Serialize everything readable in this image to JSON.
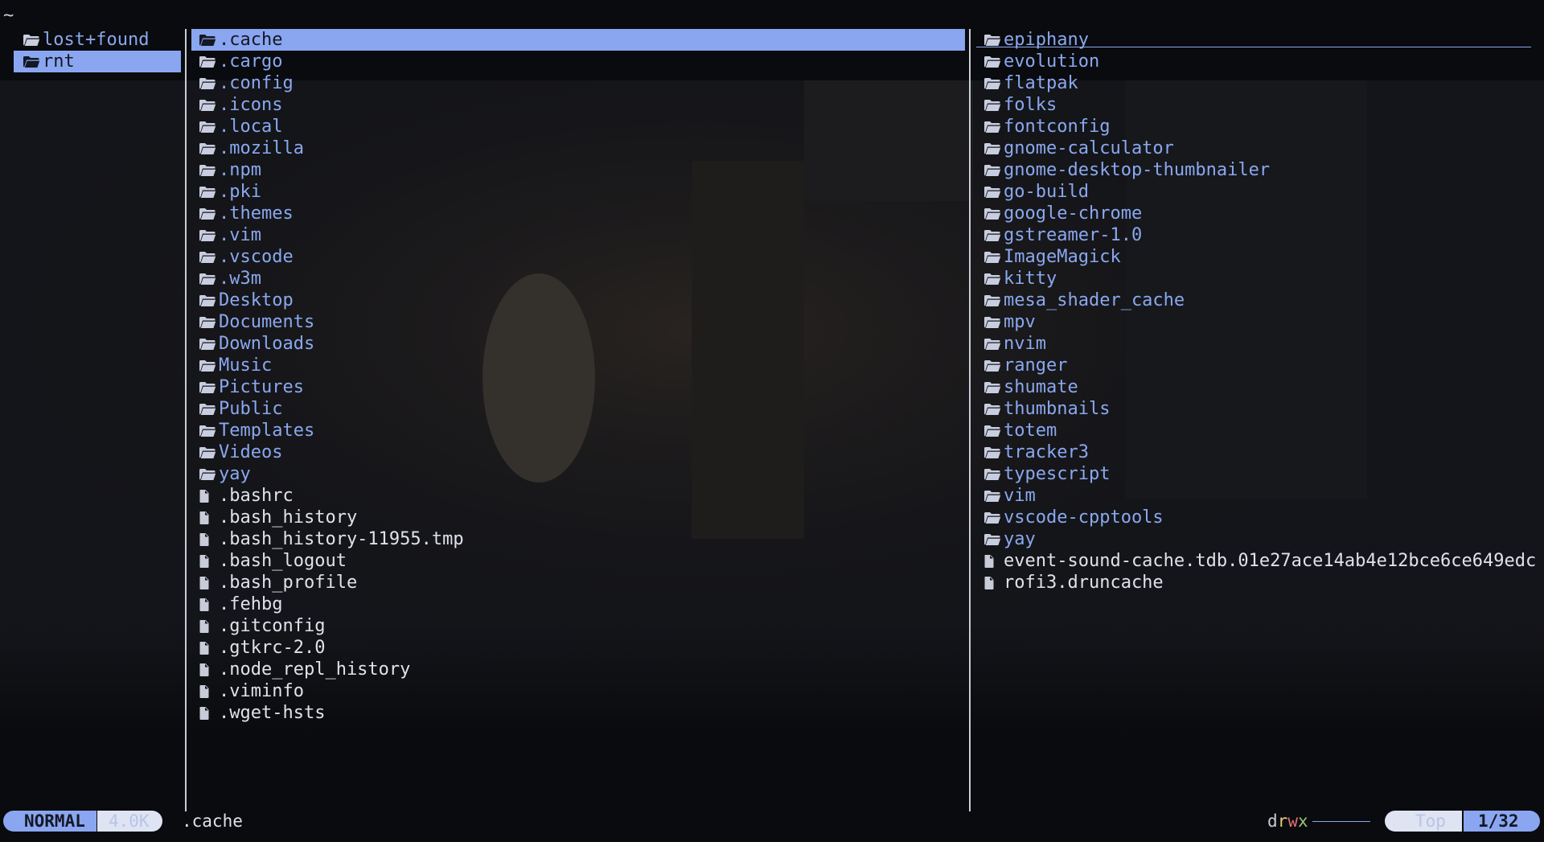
{
  "topline": "~",
  "parent_pane": {
    "items": [
      {
        "name": "lost+found",
        "type": "dir"
      },
      {
        "name": "rnt",
        "type": "dir",
        "selected": true
      }
    ]
  },
  "current_pane": {
    "items": [
      {
        "name": ".cache",
        "type": "dir",
        "selected": true
      },
      {
        "name": ".cargo",
        "type": "dir"
      },
      {
        "name": ".config",
        "type": "dir"
      },
      {
        "name": ".icons",
        "type": "dir"
      },
      {
        "name": ".local",
        "type": "dir"
      },
      {
        "name": ".mozilla",
        "type": "dir"
      },
      {
        "name": ".npm",
        "type": "dir"
      },
      {
        "name": ".pki",
        "type": "dir"
      },
      {
        "name": ".themes",
        "type": "dir"
      },
      {
        "name": ".vim",
        "type": "dir"
      },
      {
        "name": ".vscode",
        "type": "dir"
      },
      {
        "name": ".w3m",
        "type": "dir"
      },
      {
        "name": "Desktop",
        "type": "dir"
      },
      {
        "name": "Documents",
        "type": "dir"
      },
      {
        "name": "Downloads",
        "type": "dir"
      },
      {
        "name": "Music",
        "type": "dir"
      },
      {
        "name": "Pictures",
        "type": "dir"
      },
      {
        "name": "Public",
        "type": "dir"
      },
      {
        "name": "Templates",
        "type": "dir"
      },
      {
        "name": "Videos",
        "type": "dir"
      },
      {
        "name": "yay",
        "type": "dir"
      },
      {
        "name": ".bashrc",
        "type": "file"
      },
      {
        "name": ".bash_history",
        "type": "file"
      },
      {
        "name": ".bash_history-11955.tmp",
        "type": "file"
      },
      {
        "name": ".bash_logout",
        "type": "file"
      },
      {
        "name": ".bash_profile",
        "type": "file"
      },
      {
        "name": ".fehbg",
        "type": "file"
      },
      {
        "name": ".gitconfig",
        "type": "file"
      },
      {
        "name": ".gtkrc-2.0",
        "type": "file"
      },
      {
        "name": ".node_repl_history",
        "type": "file"
      },
      {
        "name": ".viminfo",
        "type": "file"
      },
      {
        "name": ".wget-hsts",
        "type": "file"
      }
    ]
  },
  "preview_pane": {
    "items": [
      {
        "name": "epiphany",
        "type": "dir"
      },
      {
        "name": "evolution",
        "type": "dir"
      },
      {
        "name": "flatpak",
        "type": "dir"
      },
      {
        "name": "folks",
        "type": "dir"
      },
      {
        "name": "fontconfig",
        "type": "dir"
      },
      {
        "name": "gnome-calculator",
        "type": "dir"
      },
      {
        "name": "gnome-desktop-thumbnailer",
        "type": "dir"
      },
      {
        "name": "go-build",
        "type": "dir"
      },
      {
        "name": "google-chrome",
        "type": "dir"
      },
      {
        "name": "gstreamer-1.0",
        "type": "dir"
      },
      {
        "name": "ImageMagick",
        "type": "dir"
      },
      {
        "name": "kitty",
        "type": "dir"
      },
      {
        "name": "mesa_shader_cache",
        "type": "dir"
      },
      {
        "name": "mpv",
        "type": "dir"
      },
      {
        "name": "nvim",
        "type": "dir"
      },
      {
        "name": "ranger",
        "type": "dir"
      },
      {
        "name": "shumate",
        "type": "dir"
      },
      {
        "name": "thumbnails",
        "type": "dir"
      },
      {
        "name": "totem",
        "type": "dir"
      },
      {
        "name": "tracker3",
        "type": "dir"
      },
      {
        "name": "typescript",
        "type": "dir"
      },
      {
        "name": "vim",
        "type": "dir"
      },
      {
        "name": "vscode-cpptools",
        "type": "dir"
      },
      {
        "name": "yay",
        "type": "dir"
      },
      {
        "name": "event-sound-cache.tdb.01e27ace14ab4e12bce6ce649edc",
        "type": "file"
      },
      {
        "name": "rofi3.druncache",
        "type": "file"
      }
    ]
  },
  "status": {
    "mode": "NORMAL",
    "size": "4.0K",
    "current_name": ".cache",
    "perm_d": "d",
    "perm_r": "r",
    "perm_w": "w",
    "perm_x": "x",
    "position": "Top",
    "count": "1/32"
  },
  "colors": {
    "accent": "#8aa6f0",
    "dir_text": "#8aa8ef",
    "file_text": "#dfe2ea",
    "background": "#0a0b0e"
  },
  "icons": {
    "dir": "folder-icon",
    "dir_open": "folder-open-icon",
    "file": "file-icon"
  }
}
